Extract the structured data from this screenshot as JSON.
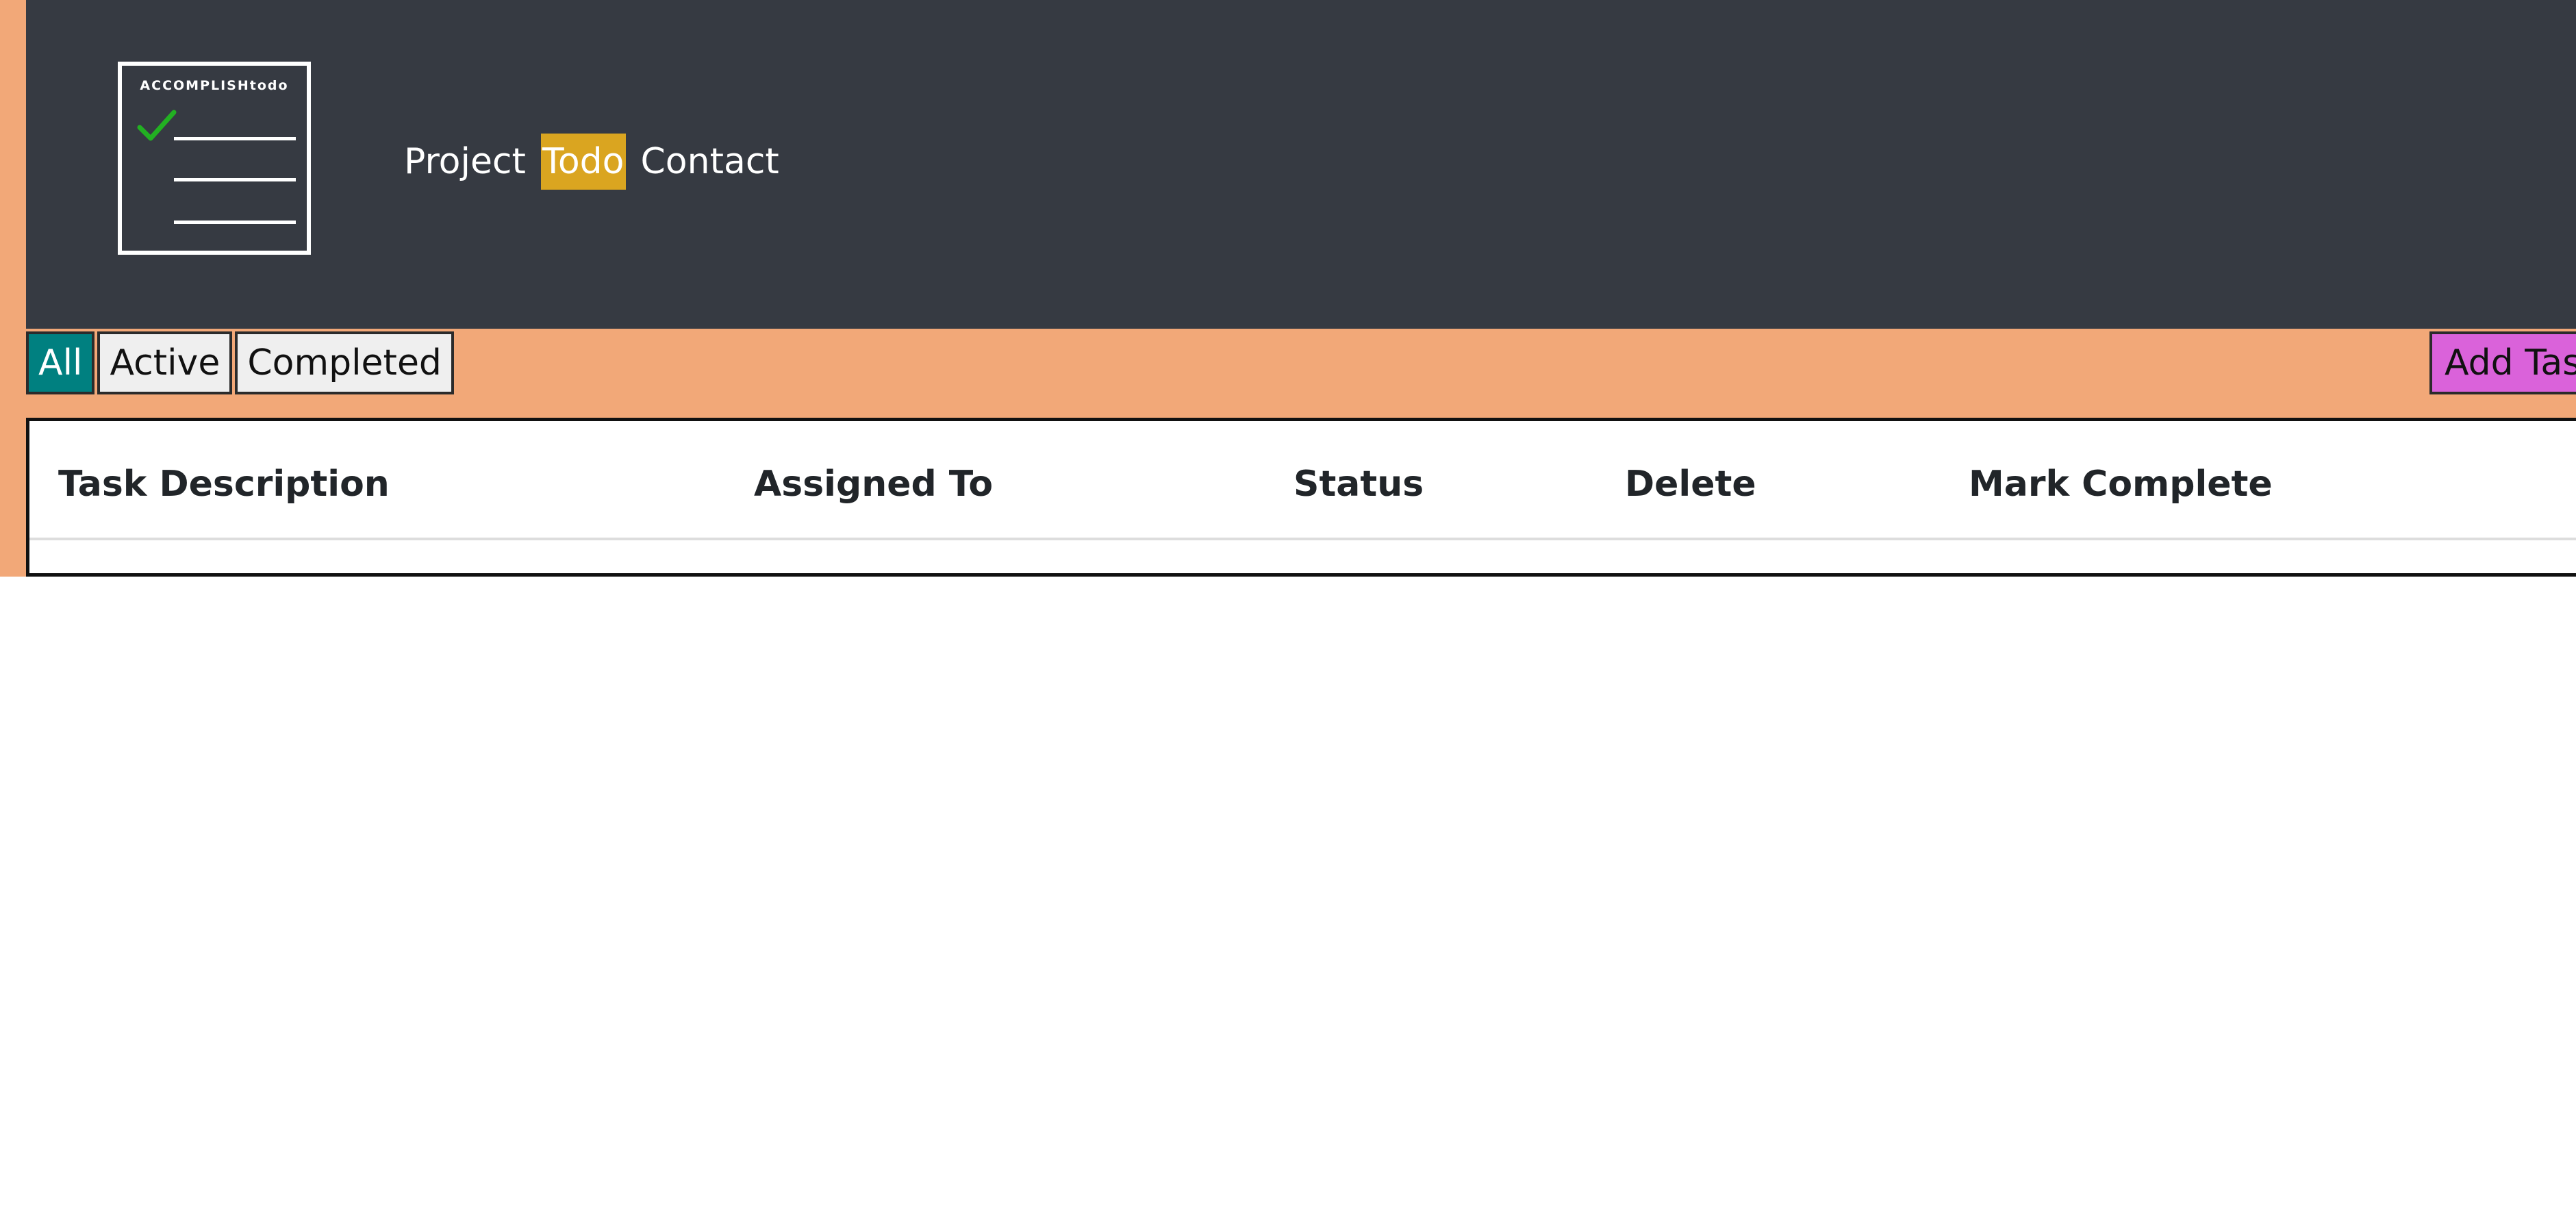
{
  "logo": {
    "text": "ACCOMPLISHtodo",
    "check_icon": "checkmark-icon",
    "check_color": "#22B022"
  },
  "nav": {
    "items": [
      {
        "label": "Project",
        "active": false
      },
      {
        "label": "Todo",
        "active": true
      },
      {
        "label": "Contact",
        "active": false
      }
    ]
  },
  "filters": {
    "items": [
      {
        "label": "All",
        "selected": true
      },
      {
        "label": "Active",
        "selected": false
      },
      {
        "label": "Completed",
        "selected": false
      }
    ]
  },
  "add_task": {
    "label": "Add Task"
  },
  "table": {
    "headers": [
      "Task Description",
      "Assigned To",
      "Status",
      "Delete",
      "Mark Complete"
    ],
    "rows": []
  },
  "colors": {
    "header_bg": "#363A42",
    "page_bg": "#F2A878",
    "active_nav_bg": "#DAA520",
    "selected_filter_bg": "#008080",
    "add_task_bg": "#DA62DA"
  }
}
